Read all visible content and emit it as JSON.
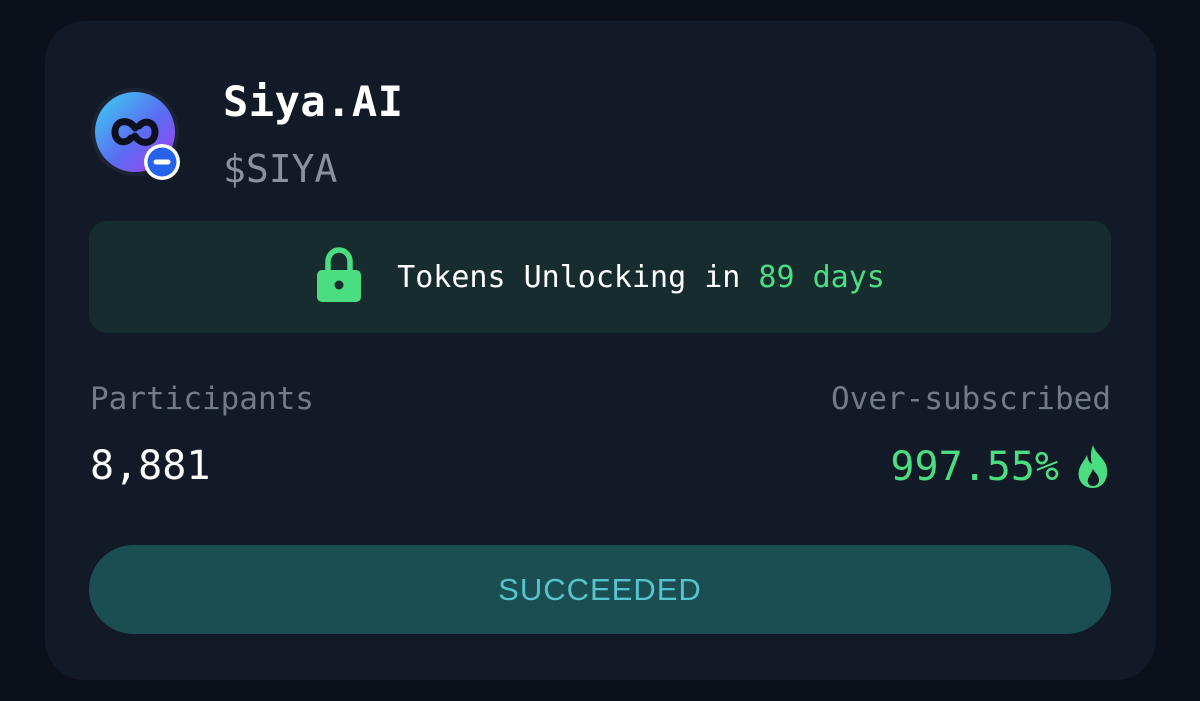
{
  "project": {
    "name": "Siya.AI",
    "ticker": "$SIYA",
    "logo_icon": "siya-logo-icon",
    "chain_badge_icon": "chain-badge-icon"
  },
  "unlock": {
    "prefix": "Tokens Unlocking in ",
    "highlight": "89 days",
    "icon": "lock-icon"
  },
  "stats": {
    "participants_label": "Participants",
    "participants_value": "8,881",
    "oversubscribed_label": "Over-subscribed",
    "oversubscribed_value": "997.55%",
    "oversubscribed_icon": "flame-icon"
  },
  "status": {
    "label": "SUCCEEDED"
  },
  "colors": {
    "background": "#0b101a",
    "card": "#121a28",
    "accent_green": "#4ade80",
    "banner_bg": "#172c2e",
    "button_bg": "#1b4e53",
    "button_text": "#56c4cc",
    "muted_text": "#737b87"
  }
}
